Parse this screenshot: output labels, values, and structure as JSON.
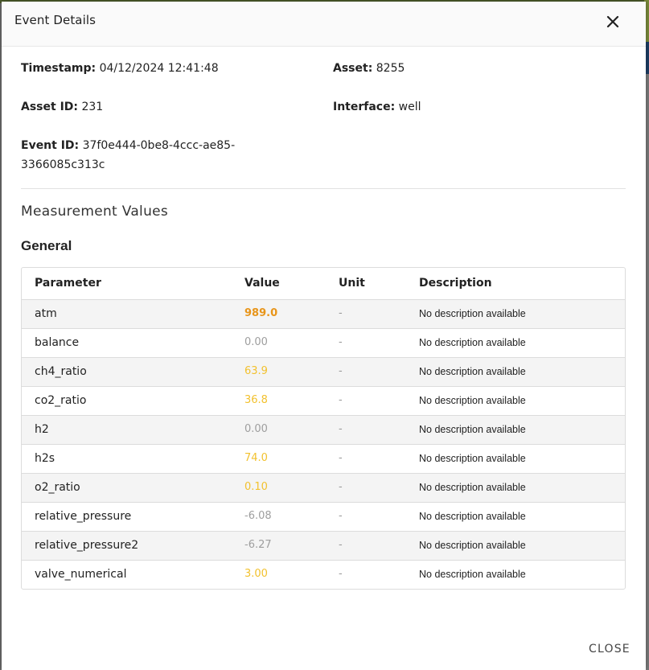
{
  "dialog": {
    "title": "Event Details",
    "close_label": "CLOSE"
  },
  "meta": {
    "timestamp_label": "Timestamp:",
    "timestamp_value": "04/12/2024 12:41:48",
    "asset_label": "Asset:",
    "asset_value": "8255",
    "asset_id_label": "Asset ID:",
    "asset_id_value": "231",
    "interface_label": "Interface:",
    "interface_value": "well",
    "event_id_label": "Event ID:",
    "event_id_line1": "37f0e444-0be8-4ccc-ae85-",
    "event_id_line2": "3366085c313c"
  },
  "section_title": "Measurement Values",
  "group_title": "General",
  "table": {
    "headers": {
      "parameter": "Parameter",
      "value": "Value",
      "unit": "Unit",
      "description": "Description"
    },
    "rows": [
      {
        "parameter": "atm",
        "value": "989.0",
        "unit": "-",
        "description": "No description available",
        "color": "#e8951a",
        "bold": true
      },
      {
        "parameter": "balance",
        "value": "0.00",
        "unit": "-",
        "description": "No description available",
        "color": "#9e9e9e",
        "bold": false
      },
      {
        "parameter": "ch4_ratio",
        "value": "63.9",
        "unit": "-",
        "description": "No description available",
        "color": "#f2c12e",
        "bold": false
      },
      {
        "parameter": "co2_ratio",
        "value": "36.8",
        "unit": "-",
        "description": "No description available",
        "color": "#f2c12e",
        "bold": false
      },
      {
        "parameter": "h2",
        "value": "0.00",
        "unit": "-",
        "description": "No description available",
        "color": "#9e9e9e",
        "bold": false
      },
      {
        "parameter": "h2s",
        "value": "74.0",
        "unit": "-",
        "description": "No description available",
        "color": "#f2c12e",
        "bold": false
      },
      {
        "parameter": "o2_ratio",
        "value": "0.10",
        "unit": "-",
        "description": "No description available",
        "color": "#f2c12e",
        "bold": false
      },
      {
        "parameter": "relative_pressure",
        "value": "-6.08",
        "unit": "-",
        "description": "No description available",
        "color": "#9e9e9e",
        "bold": false
      },
      {
        "parameter": "relative_pressure2",
        "value": "-6.27",
        "unit": "-",
        "description": "No description available",
        "color": "#9e9e9e",
        "bold": false
      },
      {
        "parameter": "valve_numerical",
        "value": "3.00",
        "unit": "-",
        "description": "No description available",
        "color": "#f2c12e",
        "bold": false
      }
    ]
  },
  "icons": {
    "close": "close-icon"
  }
}
